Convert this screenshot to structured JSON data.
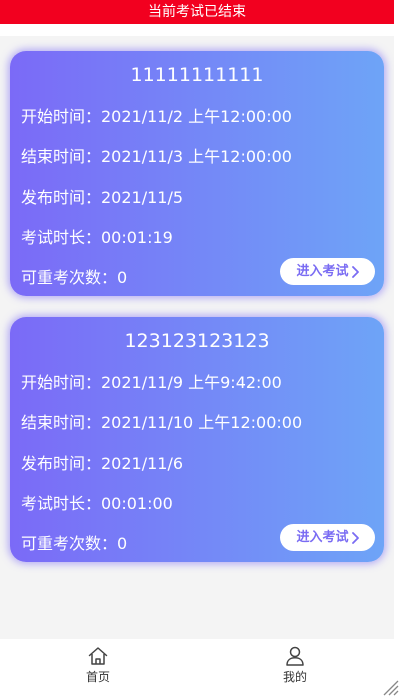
{
  "banner": {
    "text": "当前考试已结束"
  },
  "exams": [
    {
      "title": "11111111111",
      "start": "开始时间：2021/11/2 上午12:00:00",
      "end": "结束时间：2021/11/3 上午12:00:00",
      "publish": "发布时间：2021/11/5",
      "duration": "考试时长：00:01:19",
      "retakes": "可重考次数：0",
      "button_label": "进入考试"
    },
    {
      "title": "123123123123",
      "start": "开始时间：2021/11/9 上午9:42:00",
      "end": "结束时间：2021/11/10 上午12:00:00",
      "publish": "发布时间：2021/11/6",
      "duration": "考试时长：00:01:00",
      "retakes": "可重考次数：0",
      "button_label": "进入考试"
    }
  ],
  "tabbar": {
    "home_label": "首页",
    "home_icon": "home-icon",
    "mine_label": "我的",
    "mine_icon": "user-icon"
  },
  "colors": {
    "banner": "#f2001f",
    "card_gradient_start": "#7b6af7",
    "card_gradient_end": "#6ea4f7",
    "button_text": "#7a6cf3"
  }
}
